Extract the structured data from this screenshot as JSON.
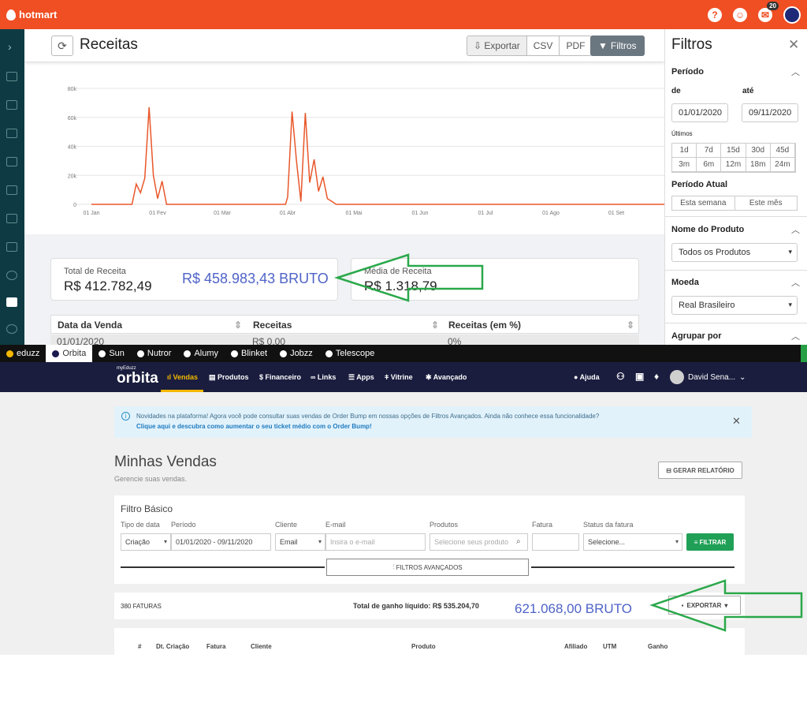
{
  "hotmart": {
    "brand": "hotmart",
    "badge_count": "20",
    "title": "Receitas",
    "buttons": {
      "exportar": "Exportar",
      "csv": "CSV",
      "pdf": "PDF",
      "filtros": "Filtros"
    },
    "cards": [
      {
        "label": "Total de Receita",
        "value": "R$ 412.782,49"
      },
      {
        "label": "Média de Receita",
        "value": "R$ 1.318,79"
      }
    ],
    "table": {
      "headers": [
        "Data da Venda",
        "Receitas",
        "Receitas (em %)"
      ],
      "row": [
        "01/01/2020",
        "R$ 0,00",
        "0%"
      ]
    },
    "filters": {
      "title": "Filtros",
      "periodo": "Período",
      "de": "de",
      "ate": "até",
      "de_value": "01/01/2020",
      "ate_value": "09/11/2020",
      "ultimos": "Últimos",
      "ranges": [
        "1d",
        "7d",
        "15d",
        "30d",
        "45d",
        "3m",
        "6m",
        "12m",
        "18m",
        "24m"
      ],
      "periodo_atual": "Período Atual",
      "atual_options": [
        "Esta semana",
        "Este mês"
      ],
      "nome_produto": "Nome do Produto",
      "produto_value": "Todos os Produtos",
      "moeda": "Moeda",
      "moeda_value": "Real Brasileiro",
      "agrupar": "Agrupar por"
    }
  },
  "chart_data": {
    "type": "line",
    "x_ticks": [
      "01 Jan",
      "01 Fev",
      "01 Mar",
      "01 Abr",
      "01 Mai",
      "01 Jun",
      "01 Jul",
      "01 Ago",
      "01 Set"
    ],
    "y_ticks": [
      "0",
      "20k",
      "40k",
      "60k",
      "80k"
    ],
    "ylim": [
      0,
      80000
    ],
    "x": [
      "01/01",
      "20/01",
      "22/01",
      "24/01",
      "26/01",
      "28/01",
      "30/01",
      "01/02",
      "03/02",
      "05/02",
      "07/02",
      "31/03",
      "01/04",
      "03/04",
      "05/04",
      "07/04",
      "09/04",
      "11/04",
      "13/04",
      "15/04",
      "17/04",
      "19/04",
      "21/04",
      "23/04",
      "01/05",
      "01/06",
      "01/07",
      "01/08",
      "01/09",
      "10/09"
    ],
    "values": [
      0,
      0,
      14000,
      8000,
      18000,
      67000,
      20000,
      4000,
      16000,
      0,
      0,
      0,
      5000,
      64000,
      30000,
      2000,
      63000,
      15000,
      31000,
      9000,
      19000,
      4000,
      2000,
      0,
      0,
      0,
      0,
      0,
      0,
      0
    ],
    "color": "#e8572a"
  },
  "overlays": {
    "bruto1": "R$ 458.983,43 BRUTO",
    "bruto2": "621.068,00 BRUTO",
    "arrow_color": "#2aa84a"
  },
  "eduzz": {
    "tabs": [
      "eduzz",
      "Orbita",
      "Sun",
      "Nutror",
      "Alumy",
      "Blinket",
      "Jobzz",
      "Telescope"
    ],
    "logo_small": "myEduzz",
    "logo": "orbita",
    "nav": [
      "Vendas",
      "Produtos",
      "Financeiro",
      "Links",
      "Apps",
      "Vitrine",
      "Avançado"
    ],
    "ajuda": "Ajuda",
    "user": "David Sena...",
    "notice_text": "Novidades na plataforma! Agora você pode consultar suas vendas de Order Bump em nossas opções de Filtros Avançados. Ainda não conhece essa funcionalidade?",
    "notice_link": "Clique aqui e descubra como aumentar o seu ticket médio com o Order Bump!",
    "title": "Minhas Vendas",
    "subtitle": "Gerencie suas vendas.",
    "gerar": "GERAR RELATÓRIO",
    "filtro_basico": "Filtro Básico",
    "labels": {
      "tipo": "Tipo de data",
      "periodo": "Período",
      "cliente": "Cliente",
      "email": "E-mail",
      "produtos": "Produtos",
      "fatura": "Fatura",
      "status": "Status da fatura"
    },
    "values": {
      "tipo": "Criação",
      "periodo": "01/01/2020  -  09/11/2020",
      "cliente": "Email",
      "email_ph": "Insira o e-mail",
      "produtos_ph": "Selecione seus produto",
      "status": "Selecione..."
    },
    "filtrar": "FILTRAR",
    "avancados": "FILTROS AVANÇADOS",
    "faturas": "380 FATURAS",
    "total_liquido": "Total de ganho líquido: R$ 535.204,70",
    "exportar": "EXPORTAR",
    "columns": [
      "#",
      "Dt. Criação",
      "Fatura",
      "Cliente",
      "Produto",
      "Afiliado",
      "UTM",
      "Ganho"
    ]
  }
}
